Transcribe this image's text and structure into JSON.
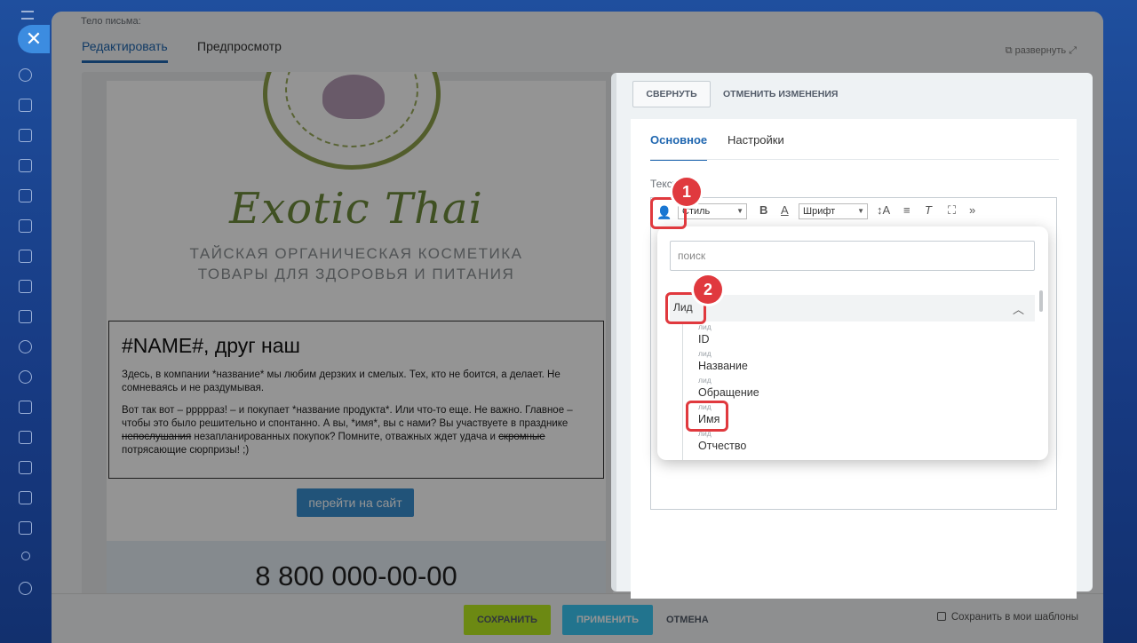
{
  "panel": {
    "body_label": "Тело письма:",
    "tabs": [
      "Редактировать",
      "Предпросмотр"
    ],
    "expand_label": "развернуть"
  },
  "email": {
    "brand": "Exotic Thai",
    "sub1": "ТАЙСКАЯ ОРГАНИЧЕСКАЯ КОСМЕТИКА",
    "sub2": "ТОВАРЫ ДЛЯ ЗДОРОВЬЯ И ПИТАНИЯ",
    "heading": "#NAME#, друг наш",
    "para1": "Здесь, в компании *название* мы любим дерзких и смелых. Тех, кто не боится, а делает. Не сомневаясь и не раздумывая.",
    "para2_a": "Вот так вот – ррррраз! – и покупает *название продукта*. Или что-то еще. Не важно. Главное – чтобы это было решительно и спонтанно. А вы, *имя*, вы с нами? Вы участвуете в празднике ",
    "para2_strike1": "непослушания",
    "para2_b": " незапланированных покупок? Помните, отважных ждет удача и ",
    "para2_strike2": "скромные",
    "para2_c": " потрясающие сюрпризы! ;)",
    "button": "перейти на сайт",
    "phone": "8 800 000-00-00"
  },
  "footer": {
    "save": "СОХРАНИТЬ",
    "apply": "ПРИМЕНИТЬ",
    "cancel": "ОТМЕНА",
    "template": "Сохранить в мои шаблоны"
  },
  "editor": {
    "collapse": "СВЕРНУТЬ",
    "undo": "ОТМЕНИТЬ ИЗМЕНЕНИЯ",
    "tabs": [
      "Основное",
      "Настройки"
    ],
    "text_label": "Текст",
    "style_select": "Стиль",
    "font_select": "Шрифт"
  },
  "popup": {
    "search_placeholder": "поиск",
    "group": "Лид",
    "fields": [
      {
        "tag": "лид",
        "name": "ID"
      },
      {
        "tag": "лид",
        "name": "Название"
      },
      {
        "tag": "лид",
        "name": "Обращение"
      },
      {
        "tag": "лид",
        "name": "Имя"
      },
      {
        "tag": "лид",
        "name": "Отчество"
      }
    ],
    "top_tag": "лид"
  },
  "annotations": {
    "badge1": "1",
    "badge2": "2"
  },
  "colors": {
    "accent": "#2067b0",
    "save": "#bbed21",
    "apply": "#3bc8f5",
    "annotation": "#e0393e"
  }
}
